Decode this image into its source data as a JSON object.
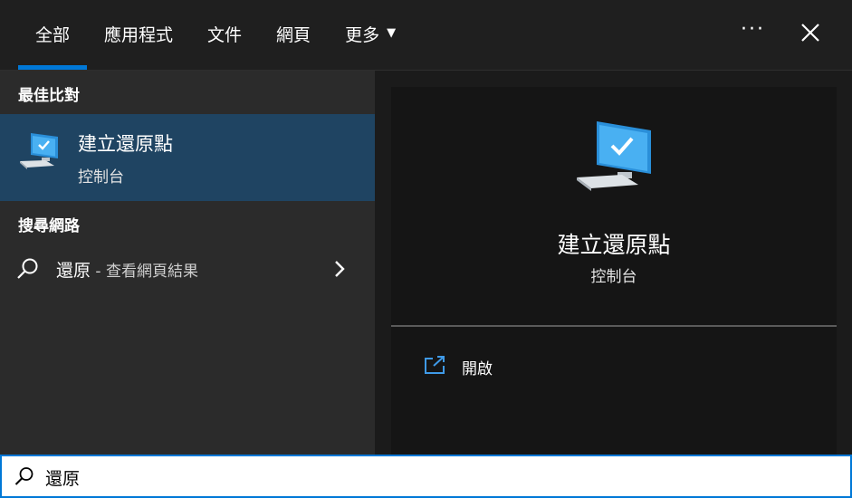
{
  "tabs": [
    {
      "label": "全部",
      "active": true
    },
    {
      "label": "應用程式"
    },
    {
      "label": "文件"
    },
    {
      "label": "網頁"
    },
    {
      "label": "更多"
    }
  ],
  "sections": {
    "best_match": "最佳比對",
    "search_web": "搜尋網路"
  },
  "best_match": {
    "title": "建立還原點",
    "subtitle": "控制台"
  },
  "web_result": {
    "query": "還原",
    "suffix": " - 查看網頁結果"
  },
  "preview": {
    "title": "建立還原點",
    "subtitle": "控制台",
    "actions": [
      {
        "label": "開啟"
      }
    ]
  },
  "search": {
    "value": "還原"
  },
  "colors": {
    "accent": "#0078d7",
    "selected": "#1f4462"
  }
}
